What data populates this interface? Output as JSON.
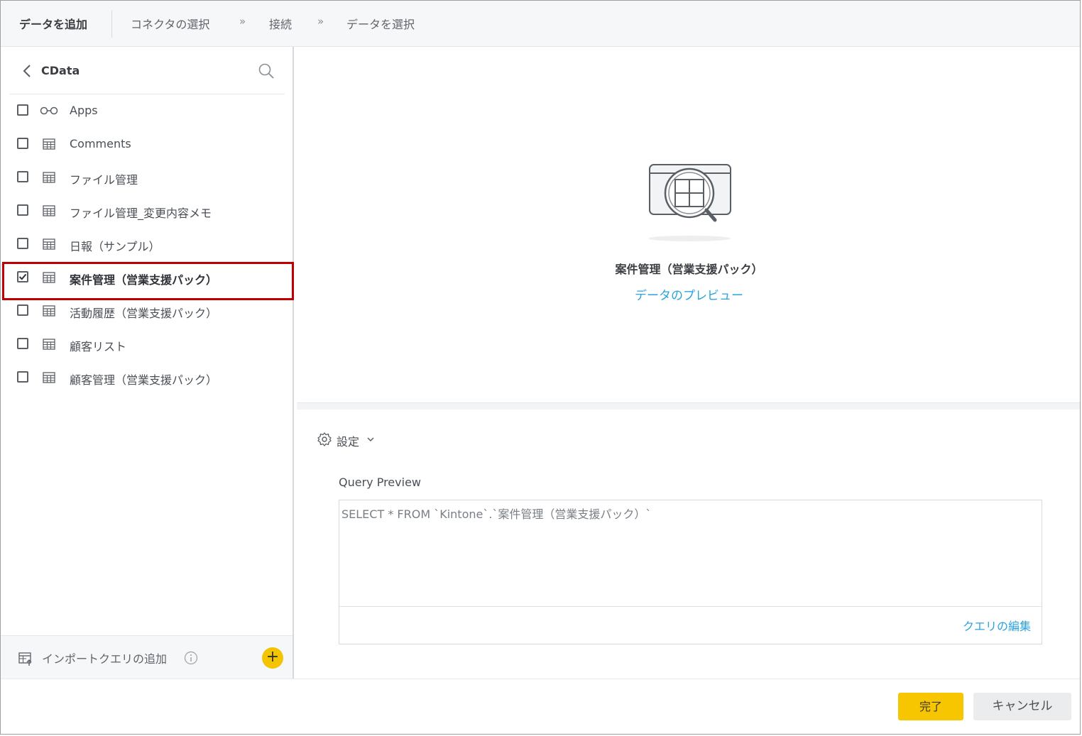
{
  "header": {
    "title": "データを追加",
    "breadcrumbs": [
      "コネクタの選択",
      "接続",
      "データを選択"
    ],
    "separator": "»"
  },
  "left": {
    "title": "CData",
    "items": [
      {
        "label": "Apps",
        "checked": false,
        "icon": "glasses-icon"
      },
      {
        "label": "Comments",
        "checked": false,
        "icon": "table-icon"
      },
      {
        "label": "ファイル管理",
        "checked": false,
        "icon": "table-icon"
      },
      {
        "label": "ファイル管理_変更内容メモ",
        "checked": false,
        "icon": "table-icon"
      },
      {
        "label": "日報（サンプル）",
        "checked": false,
        "icon": "table-icon"
      },
      {
        "label": "案件管理（営業支援パック）",
        "checked": true,
        "icon": "table-icon"
      },
      {
        "label": "活動履歴（営業支援パック）",
        "checked": false,
        "icon": "table-icon"
      },
      {
        "label": "顧客リスト",
        "checked": false,
        "icon": "table-icon"
      },
      {
        "label": "顧客管理（営業支援パック）",
        "checked": false,
        "icon": "table-icon"
      }
    ],
    "footer": {
      "label": "インポートクエリの追加",
      "add": "+"
    }
  },
  "preview": {
    "selected_name": "案件管理（営業支援パック）",
    "link": "データのプレビュー"
  },
  "settings": {
    "label": "設定"
  },
  "query": {
    "label": "Query Preview",
    "text": "SELECT * FROM `Kintone`.`案件管理（営業支援パック）`",
    "edit_link": "クエリの編集"
  },
  "buttons": {
    "done": "完了",
    "cancel": "キャンセル"
  },
  "colors": {
    "accent": "#f7c600",
    "link": "#2aa3de",
    "highlight": "#c00000"
  }
}
